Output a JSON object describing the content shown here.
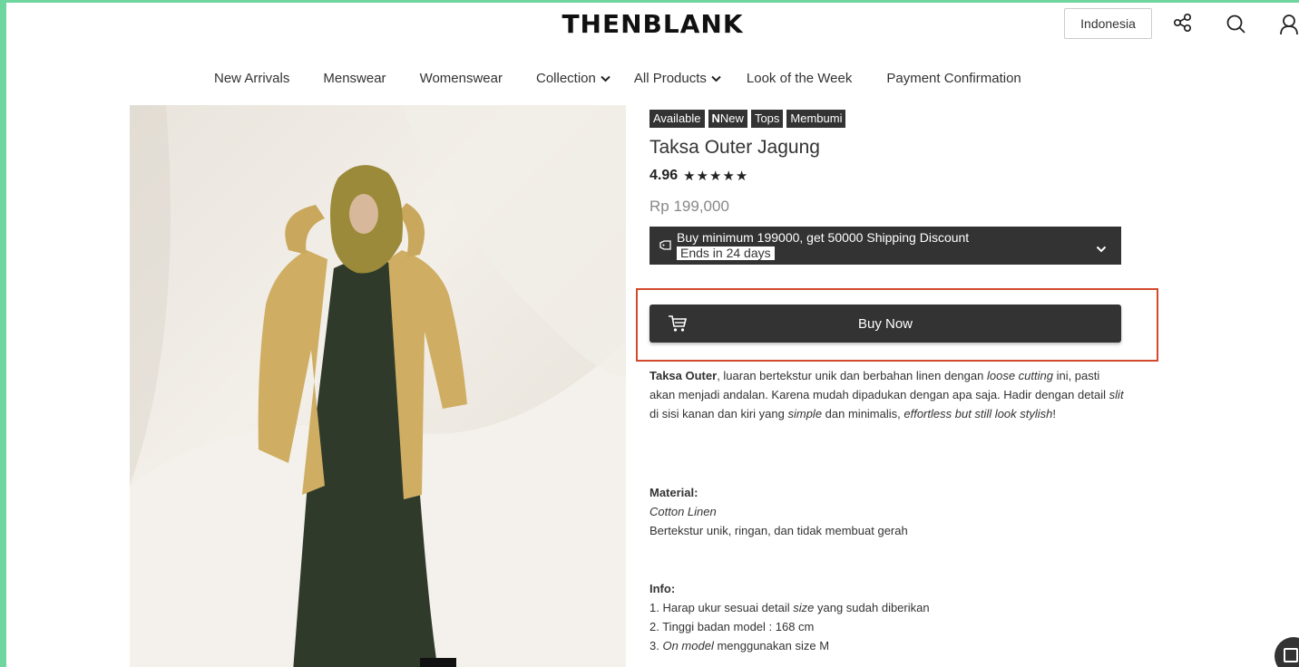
{
  "header": {
    "logo": "THENBLANK",
    "region": "Indonesia",
    "icons": [
      "share-icon",
      "search-icon",
      "user-icon"
    ]
  },
  "nav": {
    "items": [
      {
        "label": "New Arrivals",
        "dropdown": false
      },
      {
        "label": "Menswear",
        "dropdown": false
      },
      {
        "label": "Womenswear",
        "dropdown": false
      },
      {
        "label": "Collection",
        "dropdown": true
      },
      {
        "label": "All Products",
        "dropdown": true
      },
      {
        "label": "Look of the Week",
        "dropdown": false
      },
      {
        "label": "Payment Confirmation",
        "dropdown": false
      }
    ]
  },
  "product": {
    "tags": [
      "Available",
      "New",
      "Tops",
      "Membumi"
    ],
    "new_tag_prefix": "N",
    "title": "Taksa Outer Jagung",
    "rating": "4.96",
    "stars": "★★★★★",
    "price": "Rp 199,000",
    "promo": {
      "text": "Buy minimum 199000, get 50000 Shipping Discount",
      "badge": "Ends in 24 days"
    },
    "buy_label": "Buy Now",
    "description": {
      "name": "Taksa Outer",
      "part1": ", luaran bertekstur unik dan berbahan linen dengan ",
      "loose_cutting": "loose cutting",
      "part2": " ini, pasti akan menjadi andalan. Karena mudah dipadukan dengan apa saja. Hadir dengan detail ",
      "slit": "slit",
      "part3": " di sisi kanan dan kiri yang ",
      "simple": "simple",
      "part4": " dan minimalis, ",
      "effortless": "effortless but still look stylish",
      "part5": "!"
    },
    "material": {
      "label": "Material:",
      "fabric": "Cotton Linen",
      "note": "Bertekstur unik, ringan, dan tidak membuat gerah"
    },
    "info": {
      "label": "Info:",
      "line1_a": "1. Harap ukur sesuai detail ",
      "line1_size": "size",
      "line1_b": " yang sudah diberikan",
      "line2": "2. Tinggi badan model : 168 cm",
      "line3_num": "3. ",
      "line3_model": "On model",
      "line3_b": " menggunakan size M"
    }
  },
  "colors": {
    "frame": "#6fd6a0",
    "dark": "#333333",
    "highlight": "#d3492d",
    "price": "#888888"
  }
}
